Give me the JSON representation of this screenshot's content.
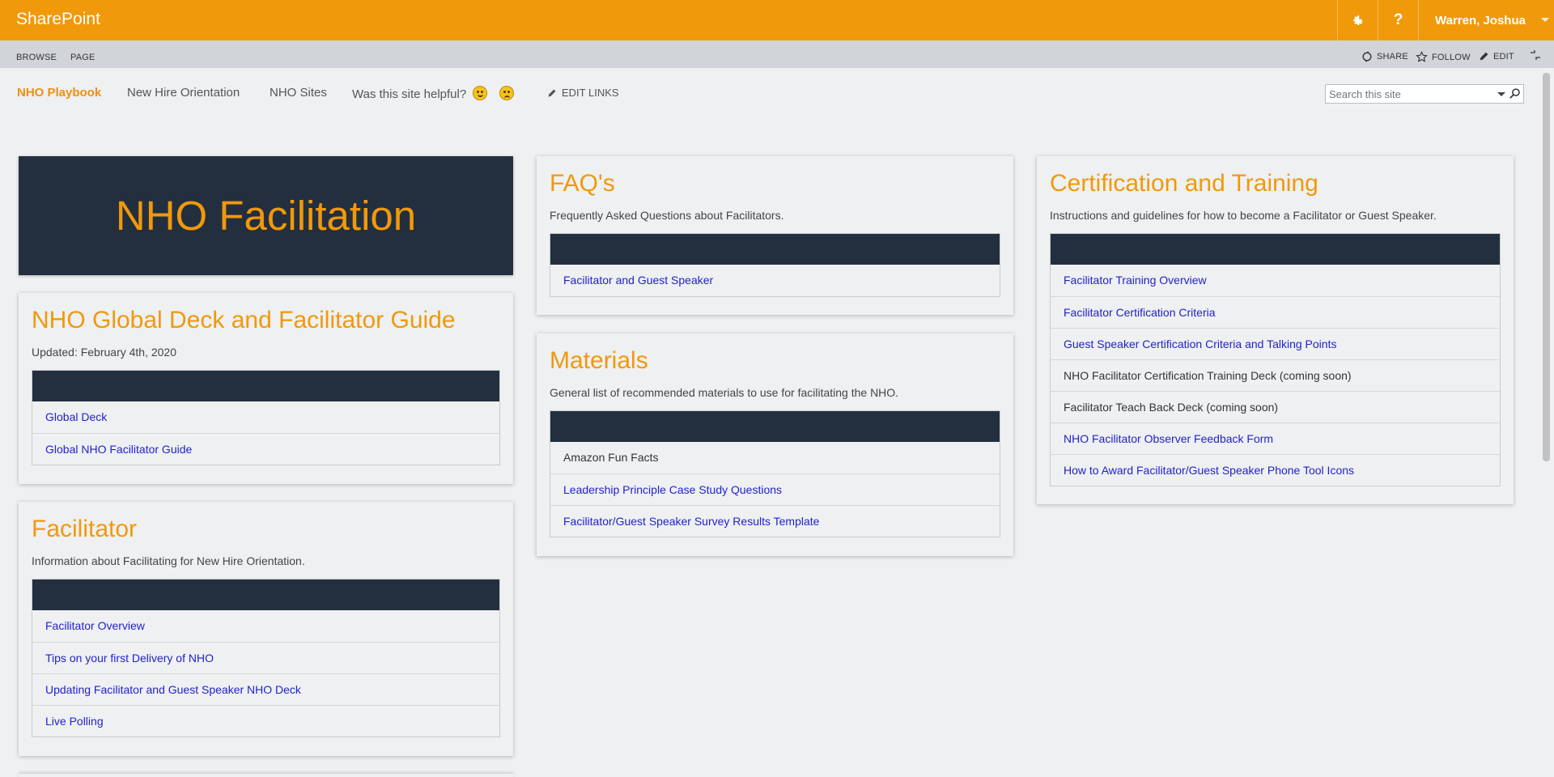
{
  "suitebar": {
    "brand": "SharePoint",
    "user": "Warren, Joshua",
    "gear_icon": "gear-icon",
    "help_label": "?",
    "bg_color": "#f0990b"
  },
  "ribbon": {
    "tabs": [
      "BROWSE",
      "PAGE"
    ],
    "share": "SHARE",
    "follow": "FOLLOW",
    "edit": "EDIT"
  },
  "nav": {
    "items": [
      "NHO Playbook",
      "New Hire Orientation",
      "NHO Sites"
    ],
    "helpful": "Was this site helpful?",
    "edit_links": "EDIT LINKS"
  },
  "search": {
    "placeholder": "Search this site"
  },
  "hero": {
    "title": "NHO Facilitation"
  },
  "cards": {
    "global": {
      "title": "NHO Global Deck and Facilitator Guide",
      "desc": "Updated: February 4th, 2020",
      "items": [
        "Global Deck",
        "Global NHO Facilitator Guide"
      ]
    },
    "facilitator": {
      "title": "Facilitator",
      "desc": "Information about Facilitating for New Hire Orientation.",
      "items": [
        "Facilitator Overview",
        "Tips on your first Delivery of NHO",
        "Updating Facilitator and Guest Speaker NHO Deck",
        "Live Polling"
      ]
    },
    "faq": {
      "title": "FAQ's",
      "desc": "Frequently Asked Questions about Facilitators.",
      "items": [
        "Facilitator and Guest Speaker"
      ]
    },
    "materials": {
      "title": "Materials",
      "desc": "General list of recommended materials to use for facilitating the NHO.",
      "items": [
        "Amazon Fun Facts",
        "Leadership Principle Case Study Questions",
        "Facilitator/Guest Speaker Survey Results Template"
      ]
    },
    "certification": {
      "title": "Certification and Training",
      "desc": "Instructions and guidelines for how to become a Facilitator or Guest Speaker.",
      "items": [
        "Facilitator Training Overview",
        "Facilitator Certification Criteria",
        "Guest Speaker Certification Criteria and Talking Points",
        "NHO Facilitator Certification Training Deck (coming soon)",
        "Facilitator Teach Back Deck (coming soon)",
        "NHO Facilitator Observer Feedback Form",
        "How to Award Facilitator/Guest Speaker Phone Tool Icons"
      ]
    }
  },
  "colors": {
    "accent": "#f0990b",
    "dark": "#232f3e",
    "link": "#2222cc"
  }
}
